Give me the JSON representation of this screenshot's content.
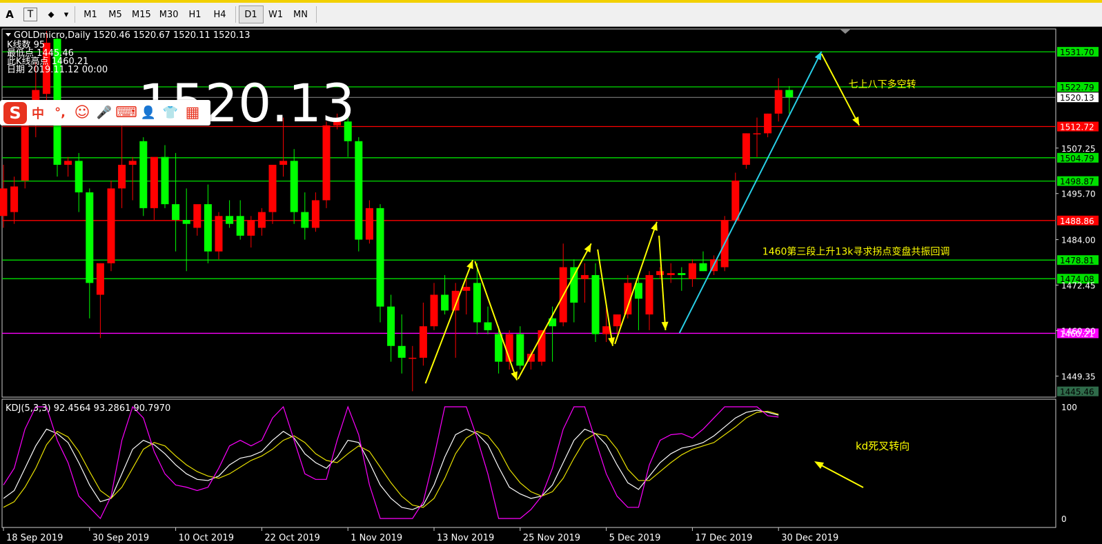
{
  "toolbar": {
    "left_items": [
      {
        "name": "text-tool-icon",
        "glyph": "A"
      },
      {
        "name": "text-label-tool-icon",
        "glyph": "T"
      },
      {
        "name": "shapes-tool-icon",
        "glyph": "⬥"
      },
      {
        "name": "dropdown-arrow-icon",
        "glyph": "▾"
      }
    ],
    "timeframes": [
      "M1",
      "M5",
      "M15",
      "M30",
      "H1",
      "H4",
      "D1",
      "W1",
      "MN"
    ],
    "active_timeframe": "D1"
  },
  "chart_header": {
    "symbol_line": "GOLDmicro,Daily  1520.46 1520.67 1520.11 1520.13",
    "info_lines": [
      "K线数  95",
      "最低点 1445.46",
      "此K线高点 1460.21",
      "日期 2019.11.12 00:00"
    ],
    "big_price": "1520.13"
  },
  "ime_toolbar": {
    "logo": "S",
    "buttons": [
      {
        "name": "chinese-mode-icon",
        "glyph": "中"
      },
      {
        "name": "punctuation-icon",
        "glyph": "°,"
      },
      {
        "name": "emoji-icon",
        "glyph": "☺"
      },
      {
        "name": "microphone-icon",
        "glyph": "🎤"
      },
      {
        "name": "keyboard-icon",
        "glyph": "⌨"
      },
      {
        "name": "user-icon",
        "glyph": "👤"
      },
      {
        "name": "skin-icon",
        "glyph": "👕"
      },
      {
        "name": "apps-grid-icon",
        "glyph": "▦"
      }
    ]
  },
  "colors": {
    "bull": "#ff0000",
    "bear": "#00ff00",
    "support_green": "#00e000",
    "resistance_red": "#ff0000",
    "low_line": "#ff00ff",
    "arrow_yellow": "#ffff00",
    "arrow_cyan": "#29d0e8",
    "kdj_k": "#ffffff",
    "kdj_d": "#e8e000",
    "kdj_j": "#ff00ff",
    "annotation": "#ffff00"
  },
  "chart_data": [
    {
      "type": "candlestick",
      "symbol": "GOLDmicro",
      "timeframe": "Daily",
      "ohlc_last": {
        "open": 1520.46,
        "high": 1520.67,
        "low": 1520.11,
        "close": 1520.13
      },
      "ylim": [
        1444.0,
        1537.5
      ],
      "y_ticks": [
        "1507.25",
        "1495.70",
        "1484.00",
        "1472.45",
        "1460.90",
        "1449.35"
      ],
      "x_ticks": [
        "18 Sep 2019",
        "30 Sep 2019",
        "10 Oct 2019",
        "22 Oct 2019",
        "1 Nov 2019",
        "13 Nov 2019",
        "25 Nov 2019",
        "5 Dec 2019",
        "17 Dec 2019",
        "30 Dec 2019"
      ],
      "x_tick_index": [
        0,
        8,
        16,
        24,
        32,
        40,
        48,
        56,
        64,
        72
      ],
      "current_price": {
        "value": 1520.13,
        "label": "1520.13"
      },
      "levels": [
        {
          "value": 1531.7,
          "label": "1531.70",
          "kind": "support"
        },
        {
          "value": 1522.79,
          "label": "1522.79",
          "kind": "support"
        },
        {
          "value": 1512.72,
          "label": "1512.72",
          "kind": "resistance"
        },
        {
          "value": 1504.79,
          "label": "1504.79",
          "kind": "support"
        },
        {
          "value": 1498.87,
          "label": "1498.87",
          "kind": "support"
        },
        {
          "value": 1488.86,
          "label": "1488.86",
          "kind": "resistance"
        },
        {
          "value": 1478.81,
          "label": "1478.81",
          "kind": "support"
        },
        {
          "value": 1474.08,
          "label": "1474.08",
          "kind": "support"
        },
        {
          "value": 1460.21,
          "label": "1460.21",
          "kind": "low"
        },
        {
          "value": 1445.46,
          "label": "1445.46",
          "kind": "bottom"
        }
      ],
      "annotations": [
        {
          "text": "七上八下多空转",
          "x_index": 78.5,
          "y": 1523.5
        },
        {
          "text": "1460第三段上升13k寻求拐点变盘共振回调",
          "x_index": 70.5,
          "y": 1481.0
        }
      ],
      "arrows": [
        {
          "color": "yellow",
          "from": [
            39.2,
            1447.5
          ],
          "to": [
            43.6,
            1478.8
          ]
        },
        {
          "color": "yellow",
          "from": [
            43.8,
            1478.5
          ],
          "to": [
            47.7,
            1448.3
          ]
        },
        {
          "color": "yellow",
          "from": [
            47.8,
            1448.6
          ],
          "to": [
            54.6,
            1483.0
          ]
        },
        {
          "color": "yellow",
          "from": [
            55.2,
            1481.5
          ],
          "to": [
            56.6,
            1457.0
          ]
        },
        {
          "color": "yellow",
          "from": [
            56.8,
            1457.5
          ],
          "to": [
            60.7,
            1488.5
          ]
        },
        {
          "color": "yellow",
          "from": [
            60.9,
            1485.0
          ],
          "to": [
            61.5,
            1461.0
          ]
        },
        {
          "color": "cyan",
          "from": [
            62.8,
            1460.3
          ],
          "to": [
            76.0,
            1531.8
          ]
        },
        {
          "color": "yellow",
          "from": [
            76.0,
            1531.2
          ],
          "to": [
            79.5,
            1513.0
          ]
        }
      ],
      "candles": [
        {
          "o": 1490.0,
          "h": 1503.0,
          "l": 1487.0,
          "c": 1497.0
        },
        {
          "o": 1491.0,
          "h": 1500.0,
          "l": 1488.0,
          "c": 1497.5
        },
        {
          "o": 1499.0,
          "h": 1518.0,
          "l": 1497.0,
          "c": 1515.0
        },
        {
          "o": 1514.0,
          "h": 1529.0,
          "l": 1510.0,
          "c": 1522.0
        },
        {
          "o": 1521.0,
          "h": 1537.0,
          "l": 1519.0,
          "c": 1534.0
        },
        {
          "o": 1535.0,
          "h": 1536.0,
          "l": 1500.0,
          "c": 1503.0
        },
        {
          "o": 1503.0,
          "h": 1505.0,
          "l": 1500.0,
          "c": 1504.0
        },
        {
          "o": 1504.0,
          "h": 1506.0,
          "l": 1491.0,
          "c": 1496.0
        },
        {
          "o": 1496.0,
          "h": 1497.0,
          "l": 1464.0,
          "c": 1473.0
        },
        {
          "o": 1470.0,
          "h": 1478.0,
          "l": 1459.0,
          "c": 1478.0
        },
        {
          "o": 1478.0,
          "h": 1499.0,
          "l": 1476.0,
          "c": 1497.0
        },
        {
          "o": 1497.0,
          "h": 1514.0,
          "l": 1492.0,
          "c": 1503.0
        },
        {
          "o": 1503.0,
          "h": 1505.0,
          "l": 1494.0,
          "c": 1504.0
        },
        {
          "o": 1509.0,
          "h": 1510.0,
          "l": 1490.0,
          "c": 1492.0
        },
        {
          "o": 1492.0,
          "h": 1500.0,
          "l": 1489.0,
          "c": 1505.0
        },
        {
          "o": 1505.0,
          "h": 1508.0,
          "l": 1492.0,
          "c": 1493.0
        },
        {
          "o": 1493.0,
          "h": 1506.0,
          "l": 1481.0,
          "c": 1489.0
        },
        {
          "o": 1489.0,
          "h": 1497.0,
          "l": 1476.0,
          "c": 1488.0
        },
        {
          "o": 1487.0,
          "h": 1490.0,
          "l": 1485.0,
          "c": 1493.0
        },
        {
          "o": 1493.0,
          "h": 1498.0,
          "l": 1478.0,
          "c": 1481.0
        },
        {
          "o": 1481.0,
          "h": 1491.0,
          "l": 1479.0,
          "c": 1490.0
        },
        {
          "o": 1490.0,
          "h": 1494.0,
          "l": 1487.0,
          "c": 1488.0
        },
        {
          "o": 1490.0,
          "h": 1494.0,
          "l": 1484.0,
          "c": 1485.0
        },
        {
          "o": 1485.0,
          "h": 1490.0,
          "l": 1482.0,
          "c": 1489.0
        },
        {
          "o": 1487.0,
          "h": 1492.0,
          "l": 1485.0,
          "c": 1491.0
        },
        {
          "o": 1491.0,
          "h": 1499.0,
          "l": 1488.0,
          "c": 1503.0
        },
        {
          "o": 1503.0,
          "h": 1515.0,
          "l": 1500.0,
          "c": 1504.0
        },
        {
          "o": 1504.0,
          "h": 1507.0,
          "l": 1488.0,
          "c": 1491.0
        },
        {
          "o": 1491.0,
          "h": 1496.0,
          "l": 1484.0,
          "c": 1487.0
        },
        {
          "o": 1487.0,
          "h": 1496.0,
          "l": 1486.0,
          "c": 1494.0
        },
        {
          "o": 1494.0,
          "h": 1514.0,
          "l": 1492.0,
          "c": 1513.0
        },
        {
          "o": 1513.0,
          "h": 1516.0,
          "l": 1512.0,
          "c": 1514.0
        },
        {
          "o": 1514.0,
          "h": 1515.0,
          "l": 1505.0,
          "c": 1509.0
        },
        {
          "o": 1509.0,
          "h": 1510.0,
          "l": 1481.0,
          "c": 1484.0
        },
        {
          "o": 1484.0,
          "h": 1494.0,
          "l": 1483.0,
          "c": 1492.0
        },
        {
          "o": 1492.0,
          "h": 1493.0,
          "l": 1463.0,
          "c": 1467.0
        },
        {
          "o": 1467.0,
          "h": 1470.0,
          "l": 1453.0,
          "c": 1457.0
        },
        {
          "o": 1457.0,
          "h": 1465.0,
          "l": 1450.0,
          "c": 1454.0
        },
        {
          "o": 1454.0,
          "h": 1457.0,
          "l": 1445.5,
          "c": 1454.0
        },
        {
          "o": 1454.0,
          "h": 1468.0,
          "l": 1452.0,
          "c": 1462.0
        },
        {
          "o": 1462.0,
          "h": 1473.0,
          "l": 1461.0,
          "c": 1470.0
        },
        {
          "o": 1470.0,
          "h": 1475.0,
          "l": 1465.0,
          "c": 1466.0
        },
        {
          "o": 1466.0,
          "h": 1473.0,
          "l": 1454.0,
          "c": 1471.0
        },
        {
          "o": 1471.0,
          "h": 1474.0,
          "l": 1465.0,
          "c": 1472.0
        },
        {
          "o": 1473.0,
          "h": 1478.0,
          "l": 1460.0,
          "c": 1463.0
        },
        {
          "o": 1463.0,
          "h": 1467.0,
          "l": 1460.0,
          "c": 1461.0
        },
        {
          "o": 1460.0,
          "h": 1462.0,
          "l": 1450.0,
          "c": 1453.0
        },
        {
          "o": 1453.0,
          "h": 1461.0,
          "l": 1451.0,
          "c": 1460.0
        },
        {
          "o": 1460.0,
          "h": 1462.0,
          "l": 1451.0,
          "c": 1452.0
        },
        {
          "o": 1453.0,
          "h": 1456.0,
          "l": 1451.0,
          "c": 1455.0
        },
        {
          "o": 1453.0,
          "h": 1461.0,
          "l": 1452.0,
          "c": 1461.0
        },
        {
          "o": 1464.0,
          "h": 1467.0,
          "l": 1453.0,
          "c": 1462.0
        },
        {
          "o": 1463.0,
          "h": 1483.0,
          "l": 1462.0,
          "c": 1477.0
        },
        {
          "o": 1477.0,
          "h": 1479.0,
          "l": 1463.0,
          "c": 1468.0
        },
        {
          "o": 1474.0,
          "h": 1478.0,
          "l": 1468.0,
          "c": 1475.0
        },
        {
          "o": 1475.0,
          "h": 1478.0,
          "l": 1458.0,
          "c": 1460.0
        },
        {
          "o": 1460.0,
          "h": 1467.0,
          "l": 1458.0,
          "c": 1462.0
        },
        {
          "o": 1462.0,
          "h": 1465.0,
          "l": 1460.0,
          "c": 1465.0
        },
        {
          "o": 1465.0,
          "h": 1475.0,
          "l": 1464.0,
          "c": 1473.0
        },
        {
          "o": 1473.0,
          "h": 1475.0,
          "l": 1461.0,
          "c": 1469.0
        },
        {
          "o": 1465.0,
          "h": 1476.0,
          "l": 1461.0,
          "c": 1475.0
        },
        {
          "o": 1475.0,
          "h": 1477.0,
          "l": 1474.0,
          "c": 1476.0
        },
        {
          "o": 1475.0,
          "h": 1478.0,
          "l": 1473.0,
          "c": 1475.5
        },
        {
          "o": 1475.5,
          "h": 1477.0,
          "l": 1471.0,
          "c": 1475.0
        },
        {
          "o": 1474.0,
          "h": 1479.0,
          "l": 1472.0,
          "c": 1478.0
        },
        {
          "o": 1478.0,
          "h": 1481.0,
          "l": 1476.0,
          "c": 1476.0
        },
        {
          "o": 1476.0,
          "h": 1480.0,
          "l": 1475.0,
          "c": 1479.0
        },
        {
          "o": 1477.0,
          "h": 1490.0,
          "l": 1476.0,
          "c": 1489.0
        },
        {
          "o": 1489.0,
          "h": 1501.0,
          "l": 1488.0,
          "c": 1499.0
        },
        {
          "o": 1503.0,
          "h": 1511.0,
          "l": 1502.0,
          "c": 1511.0
        },
        {
          "o": 1511.0,
          "h": 1515.0,
          "l": 1505.0,
          "c": 1511.0
        },
        {
          "o": 1511.0,
          "h": 1516.0,
          "l": 1510.0,
          "c": 1516.0
        },
        {
          "o": 1516.0,
          "h": 1525.0,
          "l": 1514.0,
          "c": 1522.0
        },
        {
          "o": 1522.0,
          "h": 1523.0,
          "l": 1516.0,
          "c": 1520.13
        }
      ]
    },
    {
      "type": "line",
      "indicator_label": "KDJ(5,3,3) 92.4564 93.2861 90.7970",
      "params": [
        5,
        3,
        3
      ],
      "current": {
        "K": 92.4564,
        "D": 93.2861,
        "J": 90.797
      },
      "ylim": [
        0,
        100
      ],
      "y_ticks": [
        "100",
        "0"
      ],
      "series": [
        {
          "name": "K",
          "color": "white",
          "values": [
            18,
            25,
            45,
            65,
            80,
            76,
            68,
            50,
            30,
            15,
            18,
            40,
            62,
            70,
            66,
            58,
            48,
            40,
            35,
            34,
            38,
            48,
            54,
            56,
            60,
            70,
            78,
            72,
            58,
            50,
            45,
            55,
            70,
            68,
            50,
            30,
            18,
            10,
            8,
            12,
            30,
            55,
            75,
            80,
            76,
            66,
            46,
            28,
            22,
            18,
            20,
            30,
            50,
            70,
            80,
            76,
            66,
            48,
            32,
            26,
            38,
            50,
            58,
            63,
            65,
            68,
            74,
            82,
            90,
            95,
            97,
            95,
            92.46
          ]
        },
        {
          "name": "D",
          "color": "yellow",
          "values": [
            10,
            15,
            28,
            45,
            66,
            78,
            73,
            60,
            42,
            25,
            18,
            28,
            45,
            62,
            68,
            65,
            56,
            48,
            42,
            38,
            36,
            40,
            46,
            52,
            56,
            62,
            70,
            74,
            68,
            58,
            52,
            50,
            58,
            65,
            60,
            46,
            32,
            20,
            12,
            10,
            18,
            36,
            58,
            72,
            78,
            74,
            62,
            44,
            32,
            24,
            20,
            24,
            36,
            54,
            70,
            76,
            74,
            62,
            44,
            34,
            34,
            42,
            50,
            57,
            62,
            65,
            68,
            75,
            82,
            90,
            95,
            96,
            93.29
          ]
        },
        {
          "name": "J",
          "color": "magenta",
          "values": [
            30,
            45,
            80,
            100,
            100,
            70,
            50,
            20,
            10,
            0,
            20,
            70,
            100,
            90,
            60,
            40,
            30,
            28,
            25,
            28,
            45,
            65,
            70,
            65,
            70,
            90,
            100,
            70,
            40,
            35,
            35,
            70,
            100,
            75,
            30,
            0,
            0,
            0,
            0,
            15,
            55,
            100,
            100,
            100,
            72,
            40,
            0,
            0,
            0,
            8,
            20,
            45,
            80,
            100,
            100,
            70,
            40,
            20,
            10,
            10,
            48,
            70,
            75,
            76,
            72,
            80,
            90,
            100,
            100,
            100,
            100,
            92,
            90.8
          ]
        }
      ]
    }
  ]
}
